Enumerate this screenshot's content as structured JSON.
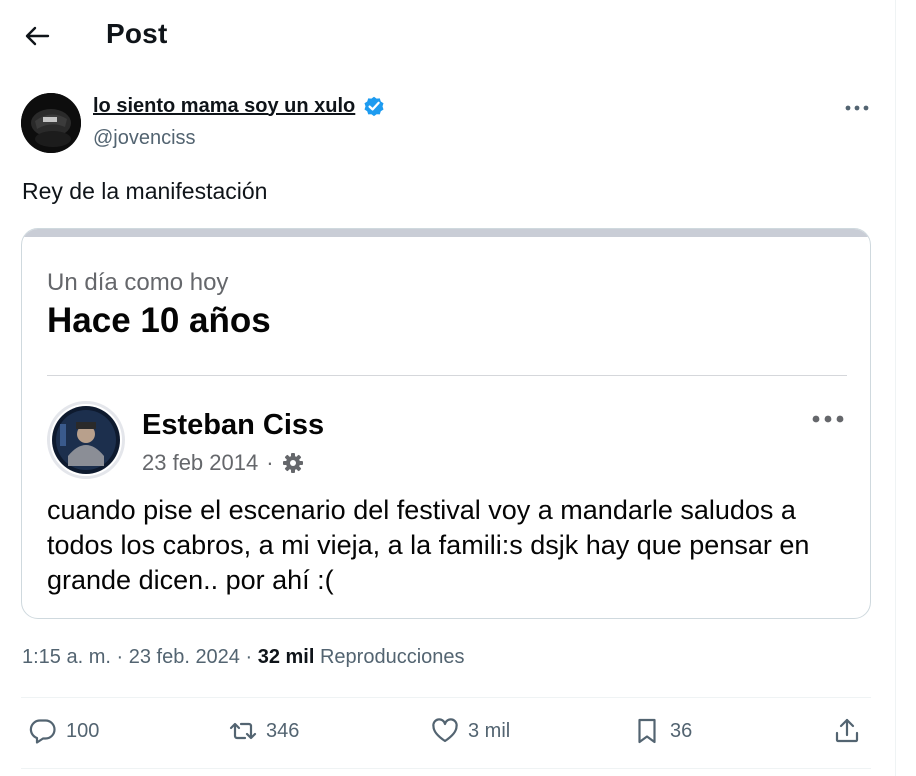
{
  "header": {
    "title": "Post"
  },
  "author": {
    "display_name": "lo siento mama soy un xulo",
    "handle": "@jovenciss",
    "verified": true
  },
  "post": {
    "text": "Rey de la manifestación"
  },
  "media": {
    "memory_subtitle": "Un día como hoy",
    "memory_title": "Hace 10 años",
    "fb_post": {
      "author": "Esteban Ciss",
      "date": "23 feb 2014",
      "text": "cuando pise el escenario del festival voy a mandarle saludos a todos los cabros, a mi vieja, a la famili:s dsjk hay que pensar en grande dicen.. por ahí :("
    }
  },
  "meta": {
    "time": "1:15 a. m.",
    "date": "23 feb. 2024",
    "views_count": "32 mil",
    "views_label": "Reproducciones"
  },
  "actions": {
    "replies": "100",
    "retweets": "346",
    "likes": "3 mil",
    "bookmarks": "36"
  },
  "colors": {
    "text_primary": "#0f1419",
    "text_secondary": "#536471",
    "verified_blue": "#1d9bf0",
    "divider": "#eff3f4"
  }
}
